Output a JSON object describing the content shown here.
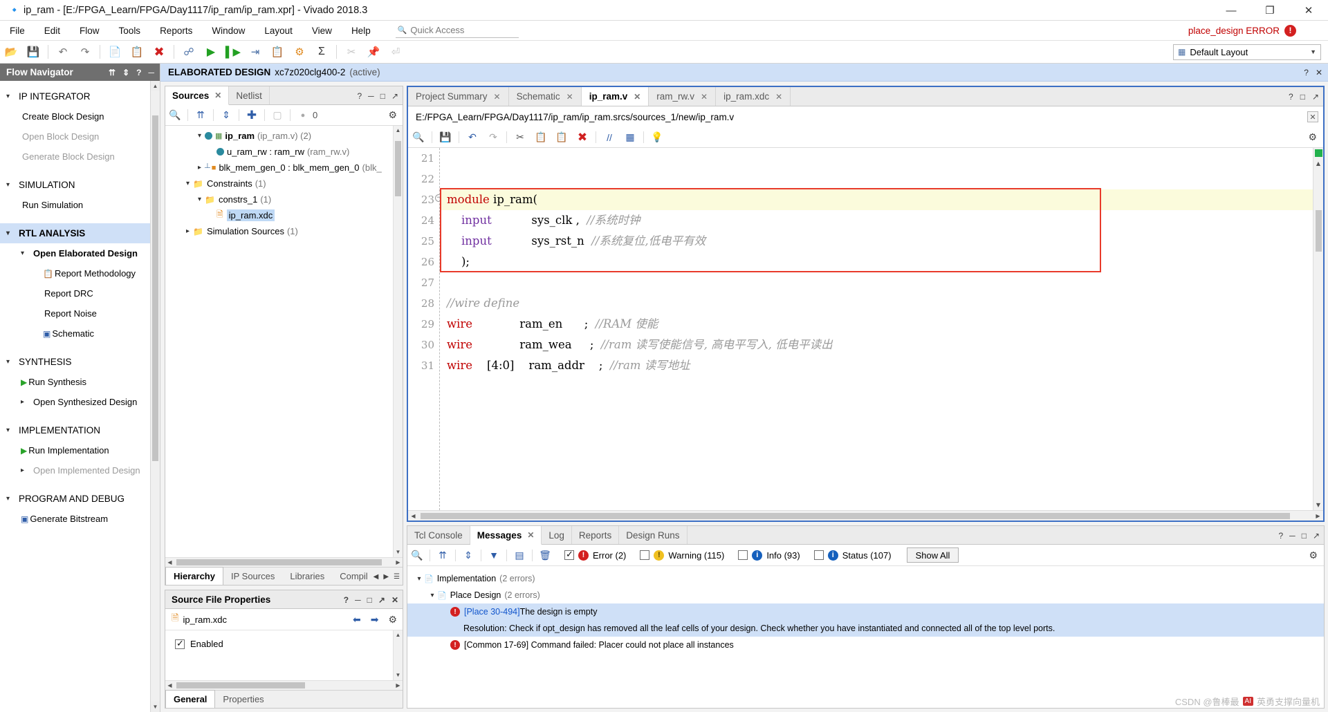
{
  "window": {
    "title": "ip_ram - [E:/FPGA_Learn/FPGA/Day1117/ip_ram/ip_ram.xpr] - Vivado 2018.3",
    "minimize": "—",
    "maximize": "❐",
    "close": "✕"
  },
  "menubar": {
    "items": [
      "File",
      "Edit",
      "Flow",
      "Tools",
      "Reports",
      "Window",
      "Layout",
      "View",
      "Help"
    ],
    "quick_access_placeholder": "Quick Access",
    "status_text": "place_design ERROR",
    "status_badge": "!"
  },
  "toolbar": {
    "layout_label": "Default Layout",
    "icons": [
      "open-folder-icon",
      "save-icon",
      "undo-icon",
      "redo-icon",
      "copy-icon",
      "paste-icon",
      "delete-icon",
      "search-replace-icon",
      "run-icon",
      "run-step-icon",
      "report-icon",
      "clipboard-icon",
      "settings-icon",
      "sigma-icon",
      "cut-disabled-icon",
      "pin-disabled-icon",
      "filter-disabled-icon"
    ]
  },
  "flow_navigator": {
    "header": "Flow Navigator",
    "sections": [
      {
        "label": "IP INTEGRATOR",
        "active": false,
        "expanded": true,
        "children": [
          {
            "label": "Create Block Design",
            "dim": false,
            "icon": ""
          },
          {
            "label": "Open Block Design",
            "dim": true,
            "icon": ""
          },
          {
            "label": "Generate Block Design",
            "dim": true,
            "icon": ""
          }
        ]
      },
      {
        "label": "SIMULATION",
        "active": false,
        "expanded": true,
        "children": [
          {
            "label": "Run Simulation",
            "dim": false,
            "icon": ""
          }
        ]
      },
      {
        "label": "RTL ANALYSIS",
        "active": true,
        "expanded": true,
        "children": [
          {
            "label": "Open Elaborated Design",
            "dim": false,
            "bold": true,
            "chev": "v",
            "icon": ""
          },
          {
            "label": "Report Methodology",
            "dim": false,
            "icon": "clipboard-check-icon",
            "indent": 3
          },
          {
            "label": "Report DRC",
            "dim": false,
            "icon": "",
            "indent": 3
          },
          {
            "label": "Report Noise",
            "dim": false,
            "icon": "",
            "indent": 3
          },
          {
            "label": "Schematic",
            "dim": false,
            "icon": "schematic-icon",
            "indent": 3
          }
        ]
      },
      {
        "label": "SYNTHESIS",
        "active": false,
        "expanded": true,
        "children": [
          {
            "label": "Run Synthesis",
            "dim": false,
            "icon": "play-icon"
          },
          {
            "label": "Open Synthesized Design",
            "dim": false,
            "chev": ">",
            "icon": ""
          }
        ]
      },
      {
        "label": "IMPLEMENTATION",
        "active": false,
        "expanded": true,
        "children": [
          {
            "label": "Run Implementation",
            "dim": false,
            "icon": "play-icon"
          },
          {
            "label": "Open Implemented Design",
            "dim": true,
            "chev": ">",
            "icon": ""
          }
        ]
      },
      {
        "label": "PROGRAM AND DEBUG",
        "active": false,
        "expanded": true,
        "children": [
          {
            "label": "Generate Bitstream",
            "dim": false,
            "icon": "bitstream-icon"
          }
        ]
      }
    ]
  },
  "design_bar": {
    "title": "ELABORATED DESIGN",
    "part": "xc7z020clg400-2",
    "state": "(active)"
  },
  "sources_panel": {
    "tabs": [
      {
        "label": "Sources",
        "active": true,
        "closable": true
      },
      {
        "label": "Netlist",
        "active": false,
        "closable": false
      }
    ],
    "toolbar_count": "0",
    "tree": [
      {
        "indent": 2,
        "chev": "v",
        "icon": "module-icon",
        "name": "ip_ram",
        "bold": true,
        "sub": "(ip_ram.v) (2)"
      },
      {
        "indent": 3,
        "chev": "",
        "icon": "instance-icon",
        "name": "u_ram_rw : ram_rw",
        "bold": false,
        "sub": "(ram_rw.v)"
      },
      {
        "indent": 2,
        "chev": ">",
        "icon": "ip-icon",
        "name": "blk_mem_gen_0 : blk_mem_gen_0",
        "bold": false,
        "sub": "(blk_"
      },
      {
        "indent": 1,
        "chev": "v",
        "icon": "folder-icon",
        "name": "Constraints",
        "bold": false,
        "sub": "(1)"
      },
      {
        "indent": 2,
        "chev": "v",
        "icon": "folder-icon",
        "name": "constrs_1",
        "bold": false,
        "sub": "(1)"
      },
      {
        "indent": 3,
        "chev": "",
        "icon": "file-icon",
        "name": "ip_ram.xdc",
        "bold": false,
        "sub": "",
        "selected": true
      },
      {
        "indent": 1,
        "chev": ">",
        "icon": "folder-icon",
        "name": "Simulation Sources",
        "bold": false,
        "sub": "(1)"
      }
    ],
    "bottom_tabs": [
      {
        "label": "Hierarchy",
        "active": true
      },
      {
        "label": "IP Sources",
        "active": false
      },
      {
        "label": "Libraries",
        "active": false
      },
      {
        "label": "Compil",
        "active": false
      }
    ]
  },
  "source_file_properties": {
    "title": "Source File Properties",
    "file_name": "ip_ram.xdc",
    "enabled_label": "Enabled",
    "enabled_checked": true,
    "tabs": [
      {
        "label": "General",
        "active": true
      },
      {
        "label": "Properties",
        "active": false
      }
    ]
  },
  "editor": {
    "tabs": [
      {
        "label": "Project Summary",
        "active": false,
        "closable": true
      },
      {
        "label": "Schematic",
        "active": false,
        "closable": true
      },
      {
        "label": "ip_ram.v",
        "active": true,
        "closable": true
      },
      {
        "label": "ram_rw.v",
        "active": false,
        "closable": true
      },
      {
        "label": "ip_ram.xdc",
        "active": false,
        "closable": true
      }
    ],
    "file_path": "E:/FPGA_Learn/FPGA/Day1117/ip_ram/ip_ram.srcs/sources_1/new/ip_ram.v",
    "lines": [
      {
        "num": "21",
        "fold": false,
        "highlight": false,
        "parts": []
      },
      {
        "num": "22",
        "fold": false,
        "highlight": false,
        "parts": []
      },
      {
        "num": "23",
        "fold": true,
        "highlight": true,
        "parts": [
          {
            "t": "module",
            "c": "kw2"
          },
          {
            "t": " ip_ram(",
            "c": ""
          }
        ]
      },
      {
        "num": "24",
        "fold": false,
        "highlight": false,
        "parts": [
          {
            "t": "    ",
            "c": ""
          },
          {
            "t": "input",
            "c": "kw"
          },
          {
            "t": "           sys_clk ,  ",
            "c": ""
          },
          {
            "t": "//系统时钟",
            "c": "cmt"
          }
        ]
      },
      {
        "num": "25",
        "fold": false,
        "highlight": false,
        "parts": [
          {
            "t": "    ",
            "c": ""
          },
          {
            "t": "input",
            "c": "kw"
          },
          {
            "t": "           sys_rst_n  ",
            "c": ""
          },
          {
            "t": "//系统复位,低电平有效",
            "c": "cmt"
          }
        ]
      },
      {
        "num": "26",
        "fold": false,
        "highlight": false,
        "parts": [
          {
            "t": "    );",
            "c": ""
          }
        ]
      },
      {
        "num": "27",
        "fold": false,
        "highlight": false,
        "parts": []
      },
      {
        "num": "28",
        "fold": false,
        "highlight": false,
        "parts": [
          {
            "t": "//wire define",
            "c": "cmt"
          }
        ]
      },
      {
        "num": "29",
        "fold": false,
        "highlight": false,
        "parts": [
          {
            "t": "wire",
            "c": "kw2"
          },
          {
            "t": "             ram_en      ;  ",
            "c": ""
          },
          {
            "t": "//RAM 使能",
            "c": "cmt"
          }
        ]
      },
      {
        "num": "30",
        "fold": false,
        "highlight": false,
        "parts": [
          {
            "t": "wire",
            "c": "kw2"
          },
          {
            "t": "             ram_wea     ;  ",
            "c": ""
          },
          {
            "t": "//ram 读写使能信号, 高电平写入, 低电平读出",
            "c": "cmt"
          }
        ]
      },
      {
        "num": "31",
        "fold": false,
        "highlight": false,
        "parts": [
          {
            "t": "wire",
            "c": "kw2"
          },
          {
            "t": "    [4:0]    ram_addr    ;  ",
            "c": ""
          },
          {
            "t": "//ram 读写地址",
            "c": "cmt"
          }
        ]
      }
    ]
  },
  "messages": {
    "tabs": [
      {
        "label": "Tcl Console",
        "active": false,
        "closable": false
      },
      {
        "label": "Messages",
        "active": true,
        "closable": true
      },
      {
        "label": "Log",
        "active": false,
        "closable": false
      },
      {
        "label": "Reports",
        "active": false,
        "closable": false
      },
      {
        "label": "Design Runs",
        "active": false,
        "closable": false
      }
    ],
    "filters": [
      {
        "label": "Error (2)",
        "checked": true,
        "severity": "error",
        "glyph": "!"
      },
      {
        "label": "Warning (115)",
        "checked": false,
        "severity": "warning",
        "glyph": "!"
      },
      {
        "label": "Info (93)",
        "checked": false,
        "severity": "info",
        "glyph": "i"
      },
      {
        "label": "Status (107)",
        "checked": false,
        "severity": "status",
        "glyph": "i"
      }
    ],
    "show_all_label": "Show All",
    "tree": [
      {
        "indent": 0,
        "chev": "v",
        "icon": "report-icon",
        "label": "Implementation",
        "count": "(2 errors)",
        "selected": false
      },
      {
        "indent": 1,
        "chev": "v",
        "icon": "report-icon",
        "label": "Place Design",
        "count": "(2 errors)",
        "selected": false
      },
      {
        "indent": 2,
        "chev": "",
        "icon": "error-icon",
        "link": "[Place 30-494]",
        "label": " The design is empty",
        "count": "",
        "selected": true
      },
      {
        "indent": 3,
        "chev": "",
        "icon": "",
        "link": "",
        "label": "Resolution: Check if opt_design has removed all the leaf cells of your design. Check whether you have instantiated and connected all of the top level ports.",
        "count": "",
        "selected": true
      },
      {
        "indent": 2,
        "chev": "",
        "icon": "error-icon",
        "link": "",
        "label": "[Common 17-69] Command failed: Placer could not place all instances",
        "count": "",
        "selected": false
      }
    ]
  },
  "watermark": {
    "text": "CSDN @鲁棒最",
    "logo": "AI",
    "suffix": "英勇支撑向量机"
  }
}
